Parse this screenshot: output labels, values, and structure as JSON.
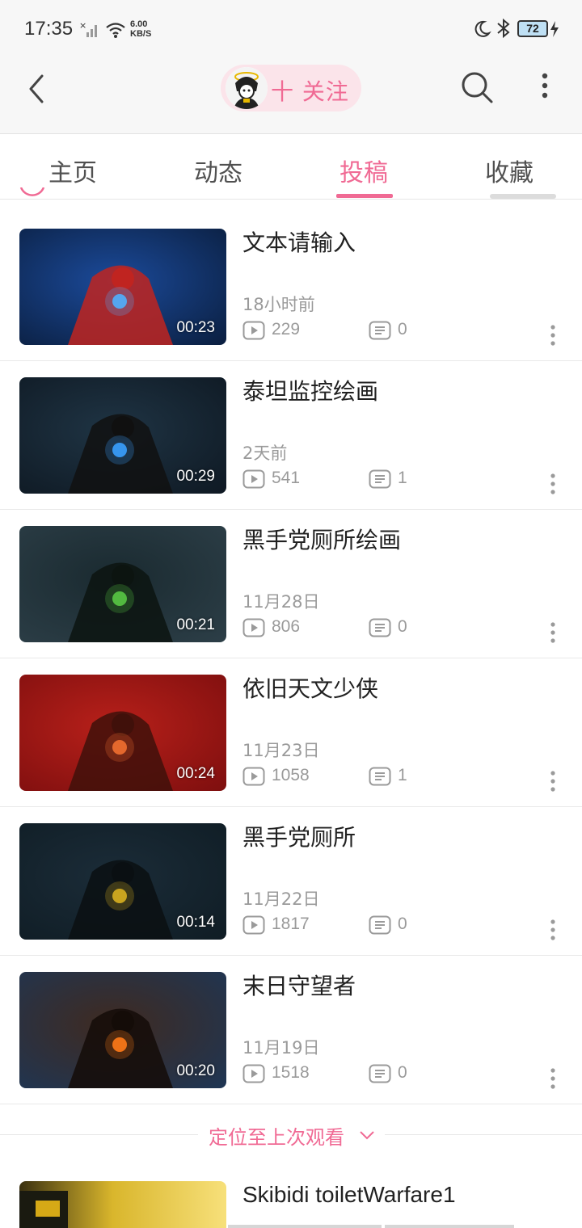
{
  "status_bar": {
    "time": "17:35",
    "net_speed_value": "6.00",
    "net_speed_unit": "KB/S",
    "battery": "72",
    "icons": [
      "signal-x-icon",
      "wifi-icon",
      "moon-icon",
      "bluetooth-icon",
      "battery-icon",
      "charging-bolt-icon"
    ]
  },
  "header": {
    "follow_label": "十 关注",
    "icons": [
      "back-arrow-icon",
      "search-icon",
      "more-vertical-icon"
    ]
  },
  "tabs": [
    {
      "label": "主页",
      "active": false
    },
    {
      "label": "动态",
      "active": false
    },
    {
      "label": "投稿",
      "active": true
    },
    {
      "label": "收藏",
      "active": false
    }
  ],
  "videos": [
    {
      "title": "文本请输入",
      "date": "18小时前",
      "plays": "229",
      "comments": "0",
      "duration": "00:23",
      "colors": [
        "#0a1d3c",
        "#1b4a9a",
        "#c02420",
        "#4fb0ff"
      ]
    },
    {
      "title": "泰坦监控绘画",
      "date": "2天前",
      "plays": "541",
      "comments": "1",
      "duration": "00:29",
      "colors": [
        "#0e1822",
        "#1f3444",
        "#101010",
        "#3aa0ff"
      ]
    },
    {
      "title": "黑手党厕所绘画",
      "date": "11月28日",
      "plays": "806",
      "comments": "0",
      "duration": "00:21",
      "colors": [
        "#2d3f48",
        "#1a2a30",
        "#0c1410",
        "#58c844"
      ]
    },
    {
      "title": "依旧天文少侠",
      "date": "11月23日",
      "plays": "1058",
      "comments": "1",
      "duration": "00:24",
      "colors": [
        "#7c0e0e",
        "#b8201a",
        "#40100a",
        "#f07030"
      ]
    },
    {
      "title": "黑手党厕所",
      "date": "11月22日",
      "plays": "1817",
      "comments": "0",
      "duration": "00:14",
      "colors": [
        "#0f1c24",
        "#1b2c38",
        "#0a0f12",
        "#d8b020"
      ]
    },
    {
      "title": "末日守望者",
      "date": "11月19日",
      "plays": "1518",
      "comments": "0",
      "duration": "00:20",
      "colors": [
        "#1d3656",
        "#3f2a20",
        "#140c08",
        "#ff7a18"
      ]
    }
  ],
  "locate_label": "定位至上次观看",
  "partial_video": {
    "title": "Skibidi toiletWarfare1"
  },
  "accent_color": "#f06a94"
}
